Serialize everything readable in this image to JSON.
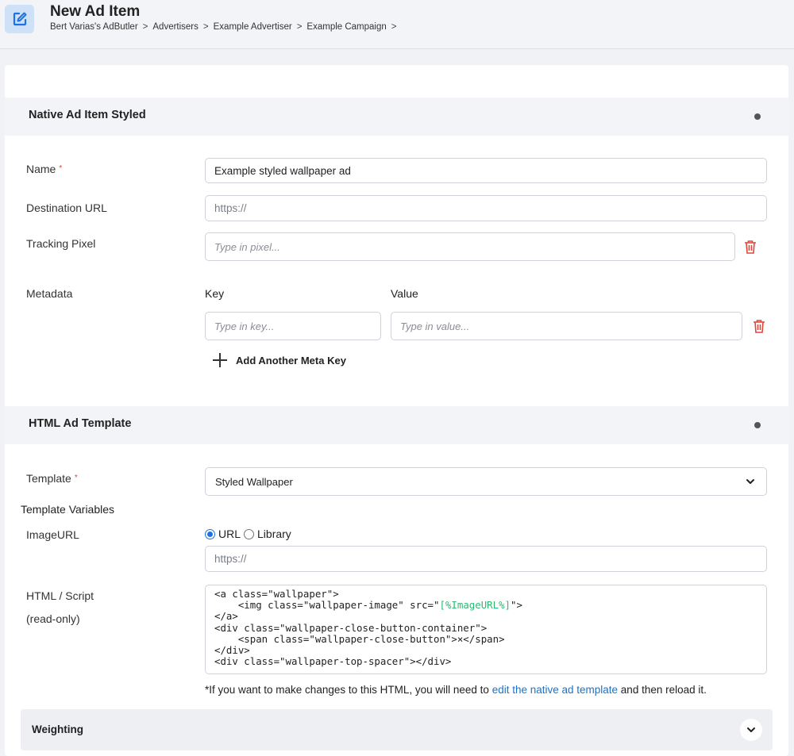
{
  "header": {
    "title": "New Ad Item",
    "icon": "edit-square-icon",
    "icon_color": "#1a73e8",
    "breadcrumb": [
      "Bert Varias's AdButler",
      "Advertisers",
      "Example Advertiser",
      "Example Campaign"
    ],
    "breadcrumb_separator": ">"
  },
  "native_section": {
    "title": "Native Ad Item Styled",
    "fields": {
      "name": {
        "label": "Name",
        "required_mark": "*",
        "value": "Example styled wallpaper ad"
      },
      "destination_url": {
        "label": "Destination URL",
        "placeholder": "https://"
      },
      "tracking_pixel": {
        "label": "Tracking Pixel",
        "placeholder": "Type in pixel..."
      }
    },
    "metadata": {
      "label": "Metadata",
      "key_header": "Key",
      "value_header": "Value",
      "key_placeholder": "Type in key...",
      "value_placeholder": "Type in value...",
      "add_label": "Add Another Meta Key"
    }
  },
  "template_section": {
    "title": "HTML Ad Template",
    "template_label": "Template",
    "required_mark": "*",
    "template_value": "Styled Wallpaper",
    "variables_label": "Template Variables",
    "image_url_label": "ImageURL",
    "source_options": [
      "URL",
      "Library"
    ],
    "source_selected": "URL",
    "image_url_placeholder": "https://",
    "html_label": "HTML / Script",
    "html_sublabel": "(read-only)",
    "code_lines": [
      [
        "<a class=\"wallpaper\">"
      ],
      [
        "    <img class=\"wallpaper-image\" src=\"",
        "[%ImageURL%]",
        "\">"
      ],
      [
        "</a>"
      ],
      [
        "<div class=\"wallpaper-close-button-container\">"
      ],
      [
        "    <span class=\"wallpaper-close-button\">×</span>"
      ],
      [
        "</div>"
      ],
      [
        "<div class=\"wallpaper-top-spacer\"></div>"
      ]
    ],
    "note_before": "*If you want to make changes to this HTML, you will need to ",
    "note_link": "edit the native ad template",
    "note_after": " and then reload it."
  },
  "weighting": {
    "title": "Weighting",
    "toggle_icon": "chevron-down-icon"
  },
  "colors": {
    "accent": "#1a73e8",
    "danger": "#e0453a",
    "variable": "#2eb872",
    "link": "#1a73c8"
  }
}
